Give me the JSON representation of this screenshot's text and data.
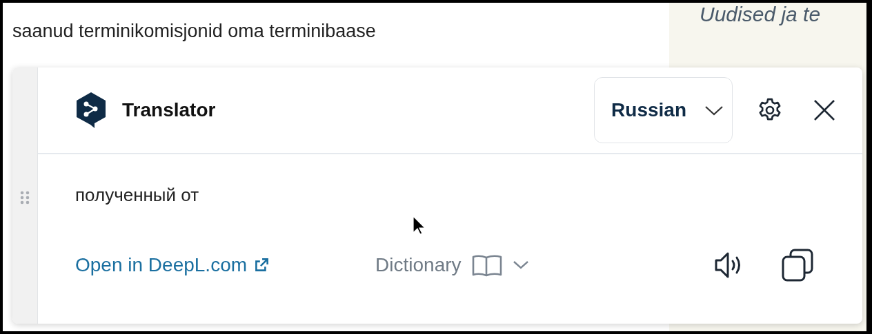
{
  "page": {
    "paragraph_line": "saanud terminikomisjonid oma terminibaase",
    "sidebar_heading": "Uudised ja te"
  },
  "translator": {
    "title": "Translator",
    "target_language": "Russian",
    "translation": "полученный от",
    "open_link": "Open in DeepL.com",
    "dictionary": "Dictionary"
  }
}
